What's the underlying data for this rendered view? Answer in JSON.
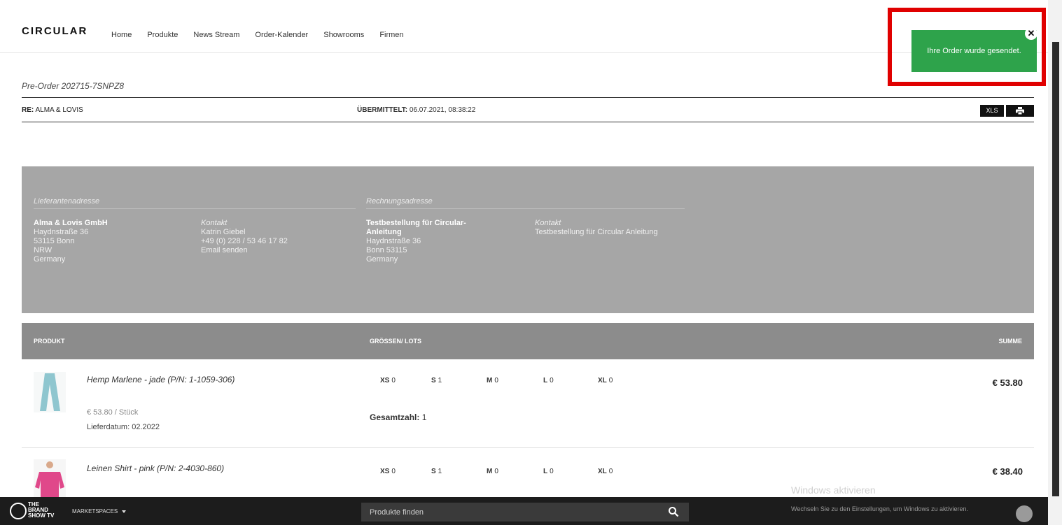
{
  "nav": {
    "logo": "CIRCULAR",
    "links": [
      "Home",
      "Produkte",
      "News Stream",
      "Order-Kalender",
      "Showrooms",
      "Firmen"
    ]
  },
  "toast": {
    "message": "Ihre Order wurde gesendet.",
    "close": "✕",
    "color": "#2ea34b",
    "highlight_color": "#e00000"
  },
  "order": {
    "title": "Pre-Order 202715-7SNPZ8",
    "re_label": "RE:",
    "re_value": "ALMA & LOVIS",
    "sent_label": "ÜBERMITTELT:",
    "sent_value": "06.07.2021, 08:38:22",
    "xls_label": "XLS",
    "print_icon": "print-icon"
  },
  "supplier": {
    "heading": "Lieferantenadresse",
    "name": "Alma & Lovis GmbH",
    "street": "Haydnstraße 36",
    "city": "53115 Bonn",
    "region": "NRW",
    "country": "Germany",
    "contact_heading": "Kontakt",
    "contact_name": "Katrin Giebel",
    "contact_phone": "+49 (0) 228 / 53 46 17 82",
    "contact_email": "Email senden"
  },
  "billing": {
    "heading": "Rechnungsadresse",
    "name_line1": "Testbestellung für Circular-",
    "name_line2": "Anleitung",
    "street": "Haydnstraße 36",
    "city": "Bonn 53115",
    "country": "Germany",
    "contact_heading": "Kontakt",
    "contact_name": "Testbestellung für Circular Anleitung"
  },
  "table": {
    "headers": {
      "product": "PRODUKT",
      "sizes": "GRÖSSEN/ LOTS",
      "sum": "SUMME"
    },
    "rows": [
      {
        "name": "Hemp Marlene - jade (P/N: 1-1059-306)",
        "price": "€ 53.80 / Stück",
        "delivery": "Lieferdatum: 02.2022",
        "sizes": [
          {
            "label": "XS",
            "qty": "0"
          },
          {
            "label": "S",
            "qty": "1"
          },
          {
            "label": "M",
            "qty": "0"
          },
          {
            "label": "L",
            "qty": "0"
          },
          {
            "label": "XL",
            "qty": "0"
          }
        ],
        "total_label": "Gesamtzahl:",
        "total_value": "1",
        "sum": "€ 53.80",
        "thumb_color": "#8fc6cf"
      },
      {
        "name": "Leinen Shirt - pink (P/N: 2-4030-860)",
        "sizes": [
          {
            "label": "XS",
            "qty": "0"
          },
          {
            "label": "S",
            "qty": "1"
          },
          {
            "label": "M",
            "qty": "0"
          },
          {
            "label": "L",
            "qty": "0"
          },
          {
            "label": "XL",
            "qty": "0"
          }
        ],
        "sum": "€ 38.40",
        "thumb_color": "#e0488a"
      }
    ]
  },
  "bottombar": {
    "brand_line1": "THE",
    "brand_line2": "BRAND",
    "brand_line3": "SHOW TV",
    "marketspaces": "MARKETSPACES",
    "search_placeholder": "Produkte finden"
  },
  "windows": {
    "title": "Windows aktivieren",
    "subtitle": "Wechseln Sie zu den Einstellungen, um Windows zu aktivieren."
  }
}
